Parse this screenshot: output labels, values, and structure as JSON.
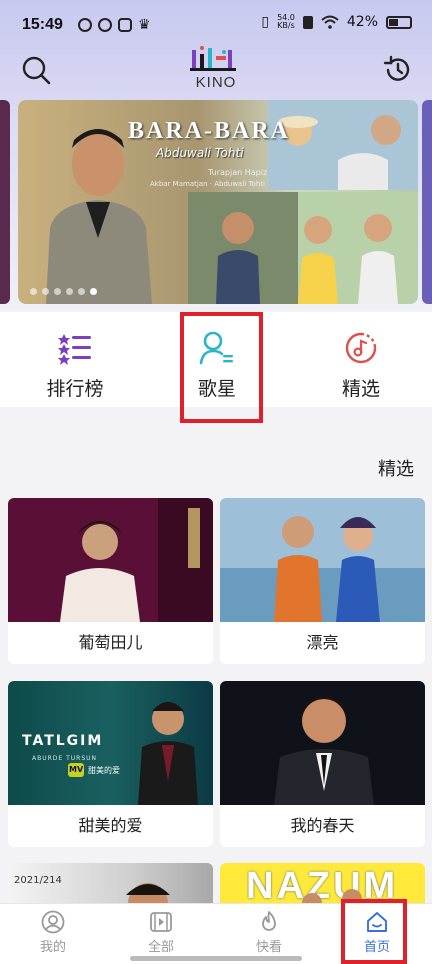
{
  "status_bar": {
    "time": "15:49",
    "net_speed_value": "54.0",
    "net_speed_unit": "KB/s",
    "battery": "42%"
  },
  "header": {
    "logo_text": "KINO",
    "search_icon": "search-icon",
    "history_icon": "history-icon"
  },
  "banner": {
    "title": "BARA-BARA",
    "artist": "Abduwali Tohti",
    "credit1": "Turapjan Hapiz",
    "credit2": "Akbar Mamatjan · Abduwali Tohti",
    "total_slides": 6,
    "active_slide": 6
  },
  "categories": [
    {
      "label": "排行榜",
      "icon": "ranking-list-icon"
    },
    {
      "label": "歌星",
      "icon": "singer-icon"
    },
    {
      "label": "精选",
      "icon": "music-disc-icon"
    }
  ],
  "section": {
    "title": "精选"
  },
  "cards": [
    {
      "label": "葡萄田儿"
    },
    {
      "label": "漂亮"
    },
    {
      "label": "甜美的爱"
    },
    {
      "label": "我的春天"
    },
    {
      "label": ""
    },
    {
      "label": ""
    }
  ],
  "card_texts": {
    "c3_latin": "TATLGIM",
    "c3_artist": "ABURDE TURSUN",
    "c3_mv": "MV",
    "c3_tag": "甜美的爱",
    "c5_year": "2021/214",
    "c6_title": "NAZUM"
  },
  "bottom_nav": [
    {
      "label": "我的",
      "icon": "profile-icon"
    },
    {
      "label": "全部",
      "icon": "video-icon"
    },
    {
      "label": "快看",
      "icon": "flame-icon"
    },
    {
      "label": "首页",
      "icon": "home-icon"
    }
  ],
  "colors": {
    "accent_red": "#e0202a",
    "active_blue": "#3a6fe0",
    "purple_icon": "#7b3fbf",
    "teal_icon": "#2bb5c8",
    "orange_icon": "#e0504a"
  }
}
